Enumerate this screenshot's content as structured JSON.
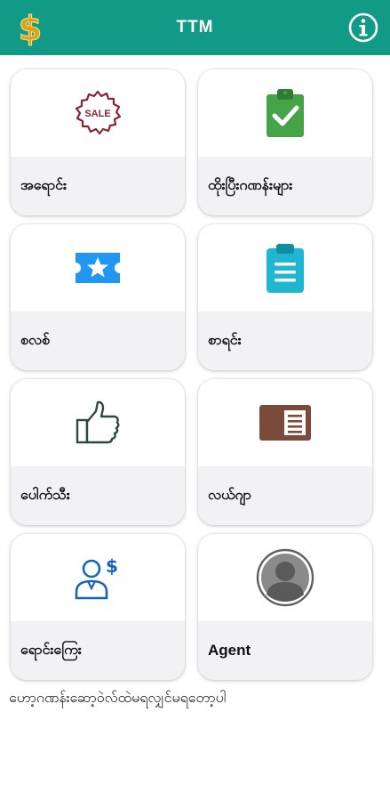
{
  "appbar": {
    "title": "TTM",
    "left_icon": "dollar-icon",
    "right_icon": "info-icon",
    "color": "#119a86"
  },
  "cards": [
    {
      "label": "အရောင်း",
      "icon": "sale-badge-icon"
    },
    {
      "label": "ထိုးပြီးဂဏန်းများ",
      "icon": "clipboard-check-icon"
    },
    {
      "label": "စလစ်",
      "icon": "ticket-star-icon"
    },
    {
      "label": "စာရင်း",
      "icon": "clipboard-list-icon"
    },
    {
      "label": "ပေါက်သီး",
      "icon": "thumbs-up-icon"
    },
    {
      "label": "လယ်ဂျာ",
      "icon": "ledger-card-icon"
    },
    {
      "label": "ရောင်းကြေး",
      "icon": "user-money-icon"
    },
    {
      "label": "Agent",
      "icon": "avatar-icon"
    }
  ],
  "footer": {
    "text": "ဟော့ဂဏန်းဆော့ဝဲလ်ထဲမရလျှင်မရတော့ပါ"
  }
}
